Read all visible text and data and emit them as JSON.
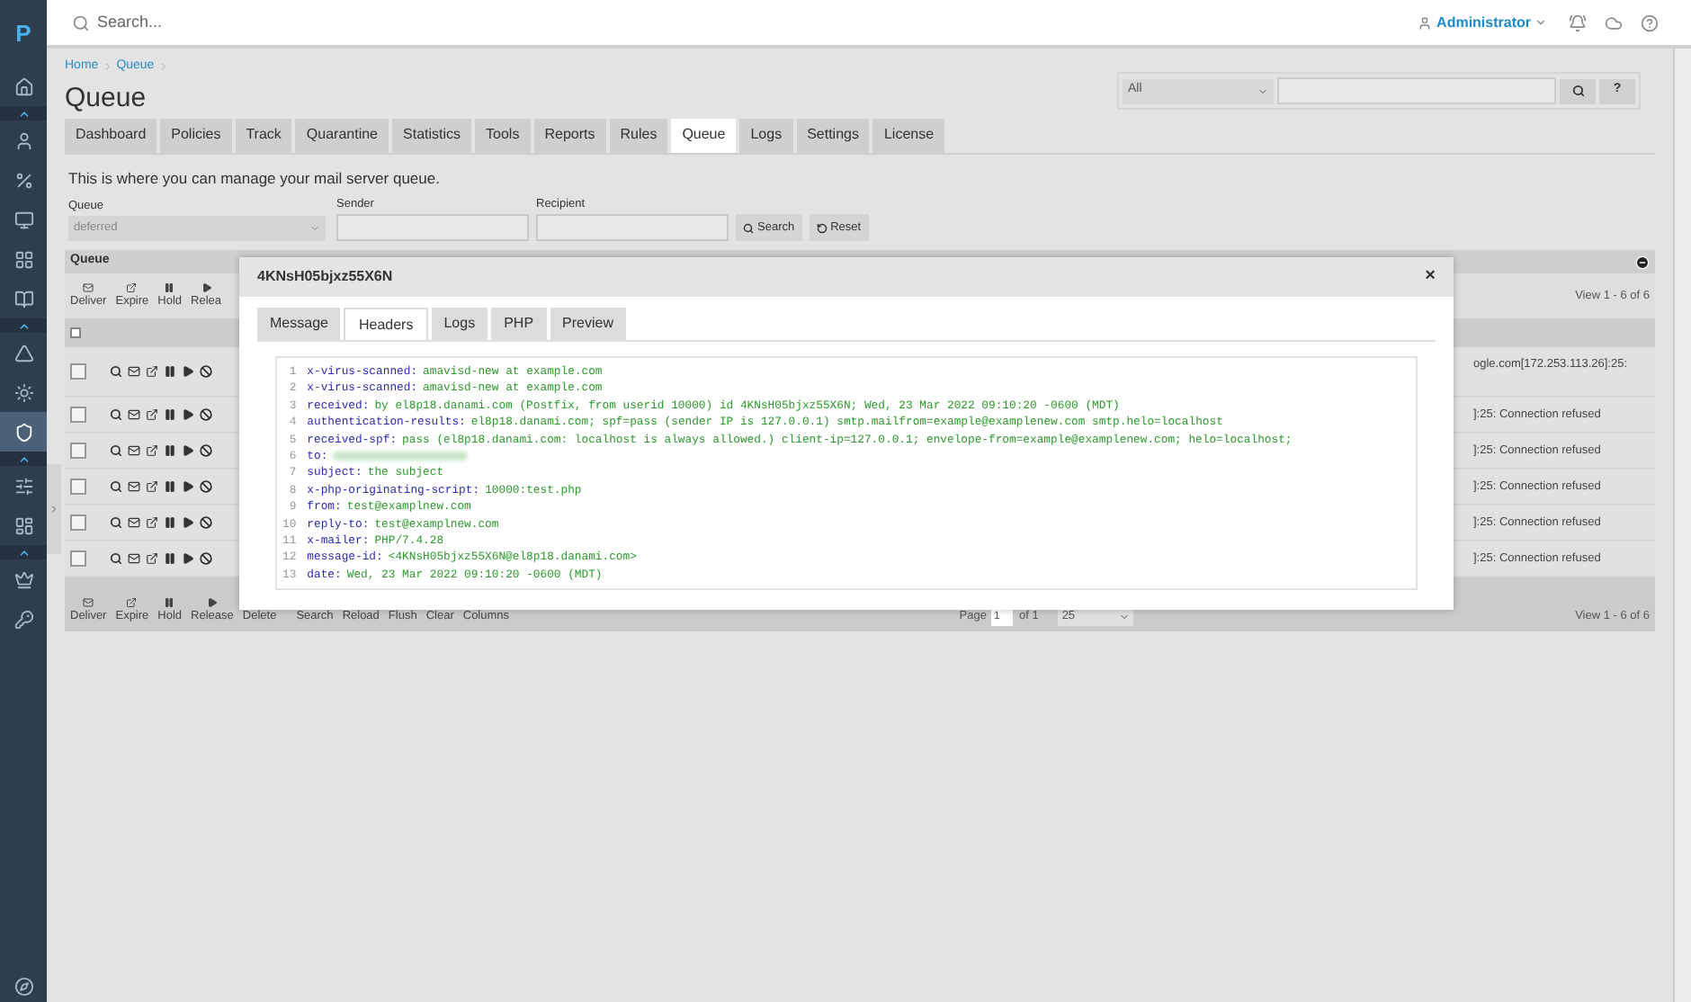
{
  "logo": "P",
  "sidebar": [
    {
      "kind": "item",
      "selected": false
    },
    {
      "kind": "section"
    },
    {
      "kind": "item",
      "selected": false
    },
    {
      "kind": "item",
      "selected": false
    },
    {
      "kind": "item",
      "selected": false
    },
    {
      "kind": "item",
      "selected": false
    },
    {
      "kind": "item",
      "selected": false
    },
    {
      "kind": "section"
    },
    {
      "kind": "item",
      "selected": false
    },
    {
      "kind": "item",
      "selected": false
    },
    {
      "kind": "item",
      "selected": true
    },
    {
      "kind": "section"
    },
    {
      "kind": "item",
      "selected": false
    },
    {
      "kind": "item",
      "selected": false
    },
    {
      "kind": "section"
    },
    {
      "kind": "item",
      "selected": false
    },
    {
      "kind": "item",
      "selected": false
    }
  ],
  "topbar": {
    "search_placeholder": "Search...",
    "user": "Administrator"
  },
  "breadcrumb": [
    "Home",
    "Queue"
  ],
  "title": "Queue",
  "quick_search": {
    "scope": "All",
    "help": "?"
  },
  "tabs": [
    {
      "label": "Dashboard",
      "selected": false
    },
    {
      "label": "Policies",
      "selected": false
    },
    {
      "label": "Track",
      "selected": false
    },
    {
      "label": "Quarantine",
      "selected": false
    },
    {
      "label": "Statistics",
      "selected": false
    },
    {
      "label": "Tools",
      "selected": false
    },
    {
      "label": "Reports",
      "selected": false
    },
    {
      "label": "Rules",
      "selected": false
    },
    {
      "label": "Queue",
      "selected": true
    },
    {
      "label": "Logs",
      "selected": false
    },
    {
      "label": "Settings",
      "selected": false
    },
    {
      "label": "License",
      "selected": false
    }
  ],
  "description": "This is where you can manage your mail server queue.",
  "filters": {
    "queue_label": "Queue",
    "queue_value": "deferred",
    "sender_label": "Sender",
    "recipient_label": "Recipient",
    "search": "Search",
    "reset": "Reset"
  },
  "grid": {
    "title": "Queue",
    "top_actions": [
      "Deliver",
      "Expire",
      "Hold",
      "Relea"
    ],
    "all_checked": false,
    "view": "View 1 - 6 of 6",
    "rows": [
      {
        "checked": false,
        "text": "ogle.com[172.253.113.26]:25:"
      },
      {
        "checked": false,
        "text": "]:25: Connection refused"
      },
      {
        "checked": false,
        "text": "]:25: Connection refused"
      },
      {
        "checked": false,
        "text": "]:25: Connection refused"
      },
      {
        "checked": false,
        "text": "]:25: Connection refused"
      },
      {
        "checked": false,
        "text": "]:25: Connection refused"
      }
    ],
    "bottom_actions": [
      {
        "kind": "icon",
        "label": "Deliver"
      },
      {
        "kind": "icon",
        "label": "Expire"
      },
      {
        "kind": "icon",
        "label": "Hold"
      },
      {
        "kind": "icon",
        "label": "Release"
      },
      {
        "kind": "text",
        "label": "Delete"
      },
      {
        "kind": "text",
        "label": "Search"
      },
      {
        "kind": "text",
        "label": "Reload"
      },
      {
        "kind": "text",
        "label": "Flush"
      },
      {
        "kind": "text",
        "label": "Clear"
      },
      {
        "kind": "text",
        "label": "Columns"
      }
    ],
    "pager": {
      "page_label": "Page",
      "page": "1",
      "of": "of 1",
      "per_page": "25"
    },
    "view_bottom": "View 1 - 6 of 6"
  },
  "modal": {
    "title": "4KNsH05bjxz55X6N",
    "close": "×",
    "tabs": [
      {
        "label": "Message",
        "selected": false
      },
      {
        "label": "Headers",
        "selected": true
      },
      {
        "label": "Logs",
        "selected": false
      },
      {
        "label": "PHP",
        "selected": false
      },
      {
        "label": "Preview",
        "selected": false
      }
    ],
    "lines": [
      {
        "number": "1",
        "key": "x-virus-scanned:",
        "value": "amavisd-new at example.com"
      },
      {
        "number": "2",
        "key": "x-virus-scanned:",
        "value": "amavisd-new at example.com"
      },
      {
        "number": "3",
        "key": "received:",
        "value": "by el8p18.danami.com (Postfix, from userid 10000) id 4KNsH05bjxz55X6N; Wed, 23 Mar 2022 09:10:20 -0600 (MDT)"
      },
      {
        "number": "4",
        "key": "authentication-results:",
        "value": "el8p18.danami.com; spf=pass (sender IP is 127.0.0.1) smtp.mailfrom=example@examplenew.com smtp.helo=localhost"
      },
      {
        "number": "5",
        "key": "received-spf:",
        "value": "pass (el8p18.danami.com: localhost is always allowed.) client-ip=127.0.0.1; envelope-from=example@examplenew.com; helo=localhost;"
      },
      {
        "number": "6",
        "key": "to:",
        "kind": "blurred"
      },
      {
        "number": "7",
        "key": "subject:",
        "value": "the subject"
      },
      {
        "number": "8",
        "key": "x-php-originating-script:",
        "value": "10000:test.php"
      },
      {
        "number": "9",
        "key": "from:",
        "value": "test@examplnew.com"
      },
      {
        "number": "10",
        "key": "reply-to:",
        "value": "test@examplnew.com"
      },
      {
        "number": "11",
        "key": "x-mailer:",
        "value": "PHP/7.4.28"
      },
      {
        "number": "12",
        "key": "message-id:",
        "value": "<4KNsH05bjxz55X6N@el8p18.danami.com>"
      },
      {
        "number": "13",
        "key": "date:",
        "value": "Wed, 23 Mar 2022 09:10:20 -0600 (MDT)"
      }
    ]
  }
}
